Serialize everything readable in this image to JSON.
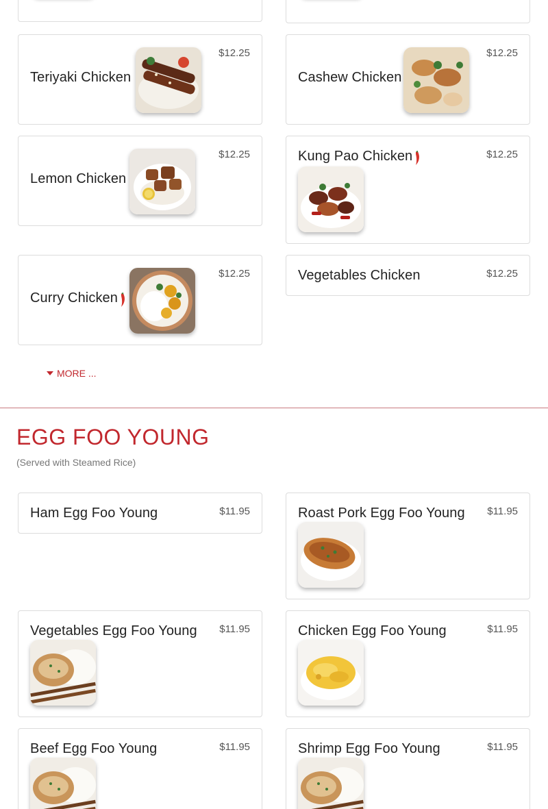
{
  "colors": {
    "accent": "#c1272d",
    "card_border": "#dcdcdc",
    "text": "#222222"
  },
  "chicken": {
    "items": [
      {
        "name": "Teriyaki Chicken",
        "price": "$12.25",
        "image": "teriyaki-chicken-photo"
      },
      {
        "name": "Cashew Chicken",
        "price": "$12.25",
        "image": "cashew-chicken-photo"
      },
      {
        "name": "Lemon Chicken",
        "price": "$12.25",
        "image": "lemon-chicken-photo"
      },
      {
        "name": "Kung Pao Chicken",
        "price": "$12.25",
        "spicy": true,
        "image": "kung-pao-chicken-photo"
      },
      {
        "name": "Curry Chicken",
        "price": "$12.25",
        "spicy": true,
        "image": "curry-chicken-photo"
      },
      {
        "name": "Vegetables Chicken",
        "price": "$12.25"
      }
    ],
    "more_label": "MORE ..."
  },
  "egg_foo_young": {
    "title": "EGG FOO YOUNG",
    "subtitle": "(Served with Steamed Rice)",
    "items": [
      {
        "name": "Ham Egg Foo Young",
        "price": "$11.95"
      },
      {
        "name": "Roast Pork Egg Foo Young",
        "price": "$11.95",
        "image": "roast-pork-egg-foo-young-photo"
      },
      {
        "name": "Vegetables Egg Foo Young",
        "price": "$11.95",
        "image": "vegetables-egg-foo-young-photo"
      },
      {
        "name": "Chicken Egg Foo Young",
        "price": "$11.95",
        "image": "chicken-egg-foo-young-photo"
      },
      {
        "name": "Beef Egg Foo Young",
        "price": "$11.95",
        "image": "beef-egg-foo-young-photo"
      },
      {
        "name": "Shrimp Egg Foo Young",
        "price": "$11.95",
        "image": "shrimp-egg-foo-young-photo"
      }
    ]
  }
}
